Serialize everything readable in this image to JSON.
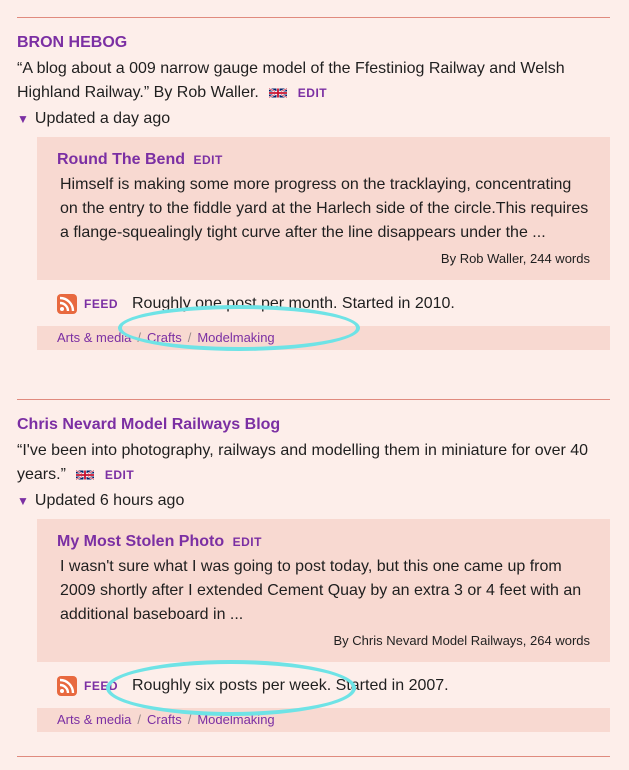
{
  "blogs": [
    {
      "title": "BRON HEBOG",
      "desc": "“A blog about a 009 narrow gauge model of the Ffestiniog Railway and Welsh Highland Railway.” By Rob Waller.",
      "edit": "EDIT",
      "updated": "Updated a day ago",
      "post": {
        "title": "Round The Bend",
        "edit": "EDIT",
        "excerpt": "Himself is making some more progress on the tracklaying, concentrating on the entry to the fiddle yard at the Harlech side of the circle.This requires a flange-squealingly tight curve after the line disappears under the ...",
        "byline": "By Rob Waller, 244 words"
      },
      "feed_label": "FEED",
      "frequency": "Roughly one post per month. Started in 2010.",
      "categories": [
        "Arts & media",
        "Crafts",
        "Modelmaking"
      ]
    },
    {
      "title": "Chris Nevard Model Railways Blog",
      "desc": "“I've been into photography, railways and modelling them in miniature for over 40 years.”",
      "edit": "EDIT",
      "updated": "Updated 6 hours ago",
      "post": {
        "title": "My Most Stolen Photo",
        "edit": "EDIT",
        "excerpt": "I wasn't sure what I was going to post today, but this one came up from 2009 shortly after I extended Cement Quay by an extra 3 or 4 feet with an additional baseboard in ...",
        "byline": "By Chris Nevard Model Railways, 264 words"
      },
      "feed_label": "FEED",
      "frequency": "Roughly six posts per week. Started in 2007.",
      "categories": [
        "Arts & media",
        "Crafts",
        "Modelmaking"
      ]
    }
  ],
  "colors": {
    "link": "#7b2fa3",
    "card": "#f8d9d1",
    "page": "#fdeeea",
    "rule": "#e08a7e",
    "highlight": "#6ee3e6"
  },
  "icons": [
    "uk-flag-icon",
    "disclosure-triangle-icon",
    "rss-feed-icon"
  ]
}
